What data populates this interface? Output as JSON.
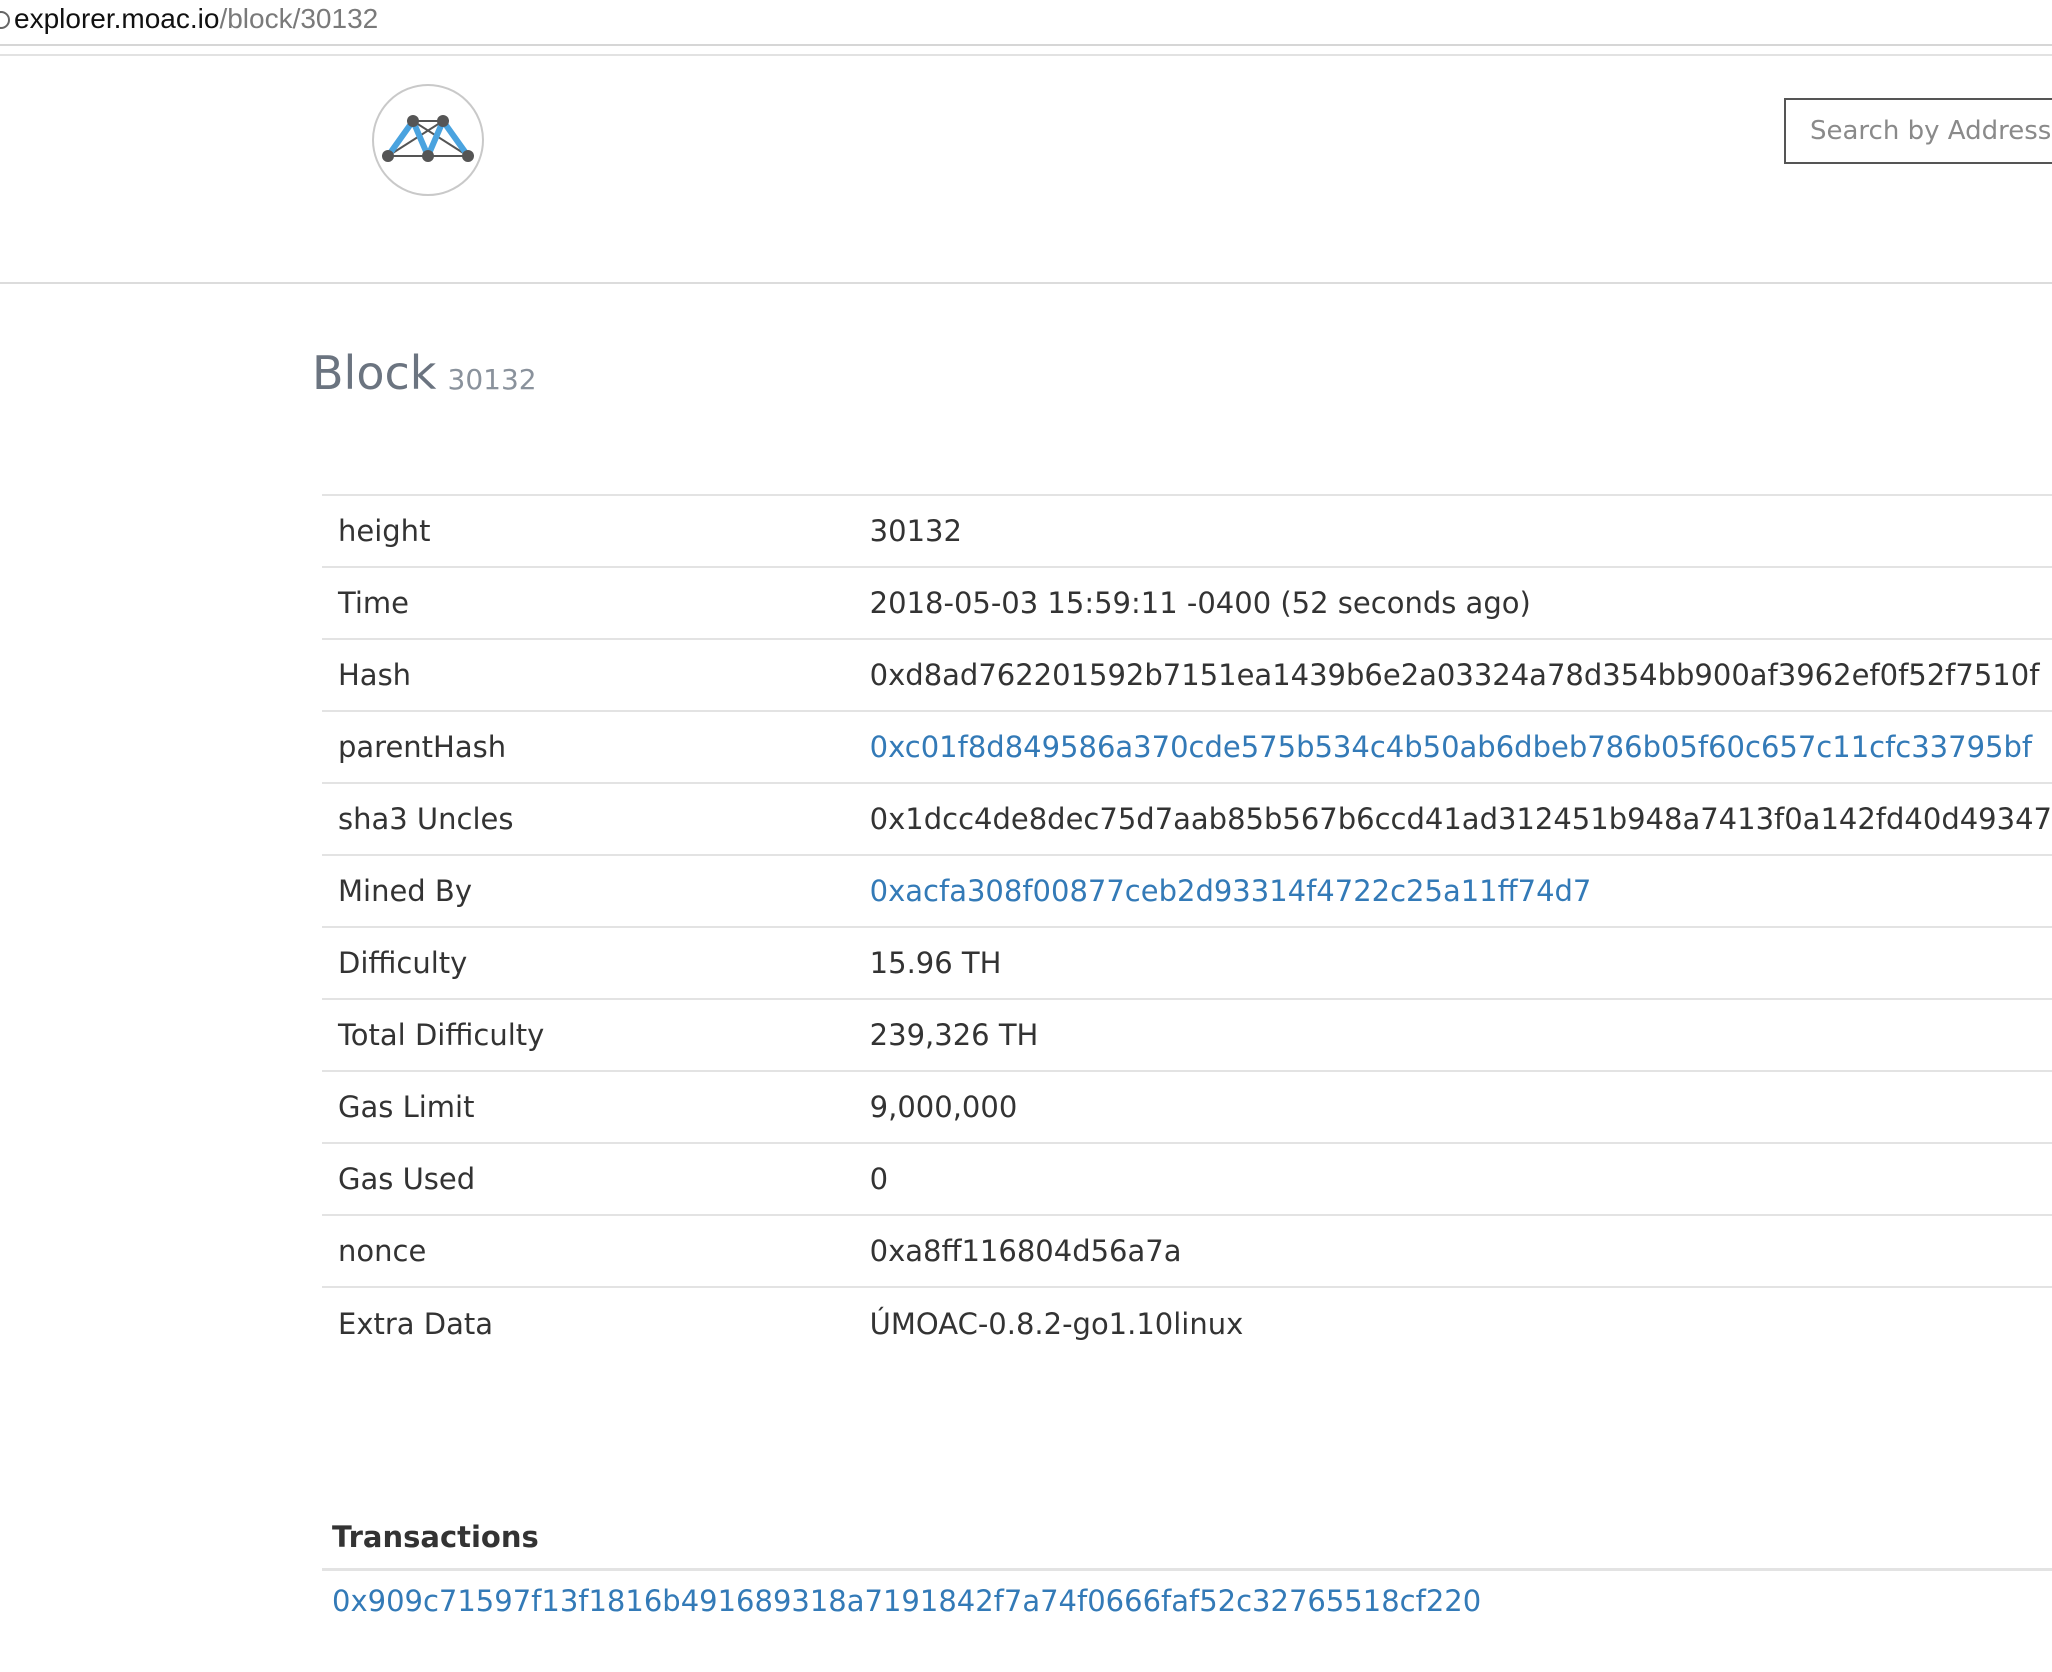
{
  "browser": {
    "url_host": "explorer.moac.io",
    "url_path": "/block/30132"
  },
  "header": {
    "logo": "moac-logo-icon",
    "search_placeholder": "Search by Address / Txhash / Block"
  },
  "page": {
    "title": "Block",
    "block_number": "30132"
  },
  "details": [
    {
      "label": "height",
      "value": "30132",
      "is_link": false
    },
    {
      "label": "Time",
      "value": "2018-05-03 15:59:11 -0400 (52 seconds ago)",
      "is_link": false
    },
    {
      "label": "Hash",
      "value": "0xd8ad762201592b7151ea1439b6e2a03324a78d354bb900af3962ef0f52f7510f",
      "is_link": false
    },
    {
      "label": "parentHash",
      "value": "0xc01f8d849586a370cde575b534c4b50ab6dbeb786b05f60c657c11cfc33795bf",
      "is_link": true
    },
    {
      "label": "sha3 Uncles",
      "value": "0x1dcc4de8dec75d7aab85b567b6ccd41ad312451b948a7413f0a142fd40d49347",
      "is_link": false
    },
    {
      "label": "Mined By",
      "value": "0xacfa308f00877ceb2d93314f4722c25a11ff74d7",
      "is_link": true
    },
    {
      "label": "Difficulty",
      "value": "15.96 TH",
      "is_link": false
    },
    {
      "label": "Total Difficulty",
      "value": "239,326 TH",
      "is_link": false
    },
    {
      "label": "Gas Limit",
      "value": "9,000,000",
      "is_link": false
    },
    {
      "label": "Gas Used",
      "value": "0",
      "is_link": false
    },
    {
      "label": "nonce",
      "value": "0xa8ff116804d56a7a",
      "is_link": false
    },
    {
      "label": "Extra Data",
      "value": "ÚMOAC-0.8.2-go1.10linux",
      "is_link": false
    }
  ],
  "transactions": {
    "heading": "Transactions",
    "items": [
      "0x909c71597f13f1816b491689318a7191842f7a74f0666faf52c32765518cf220"
    ]
  },
  "colors": {
    "link": "#337ab7",
    "title": "#6b7480",
    "logo_accent": "#4aa3df"
  }
}
